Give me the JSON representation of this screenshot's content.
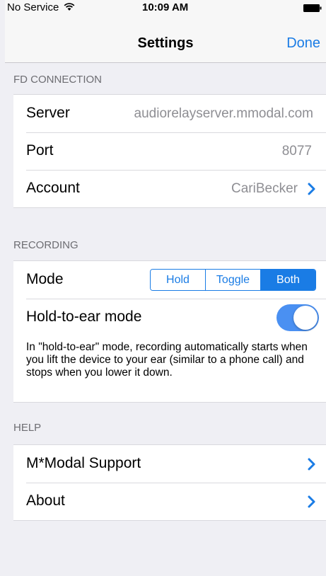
{
  "status_bar": {
    "carrier": "No Service",
    "time": "10:09 AM"
  },
  "nav": {
    "title": "Settings",
    "done_label": "Done"
  },
  "sections": {
    "fd_connection": {
      "header": "FD CONNECTION",
      "server_label": "Server",
      "server_value": "audiorelayserver.mmodal.com",
      "port_label": "Port",
      "port_value": "8077",
      "account_label": "Account",
      "account_value": "CariBecker"
    },
    "recording": {
      "header": "RECORDING",
      "mode_label": "Mode",
      "mode_options": [
        "Hold",
        "Toggle",
        "Both"
      ],
      "mode_selected": "Both",
      "hold_to_ear_label": "Hold-to-ear mode",
      "hold_to_ear_on": true,
      "hold_to_ear_description": "In \"hold-to-ear\" mode, recording automatically starts when you lift the device to your ear (similar to a phone call) and stops when you lower it down."
    },
    "help": {
      "header": "HELP",
      "support_label": "M*Modal Support",
      "about_label": "About"
    }
  },
  "colors": {
    "accent": "#1a7ce5",
    "toggle_on": "#4a90f2",
    "background": "#efeff4"
  }
}
